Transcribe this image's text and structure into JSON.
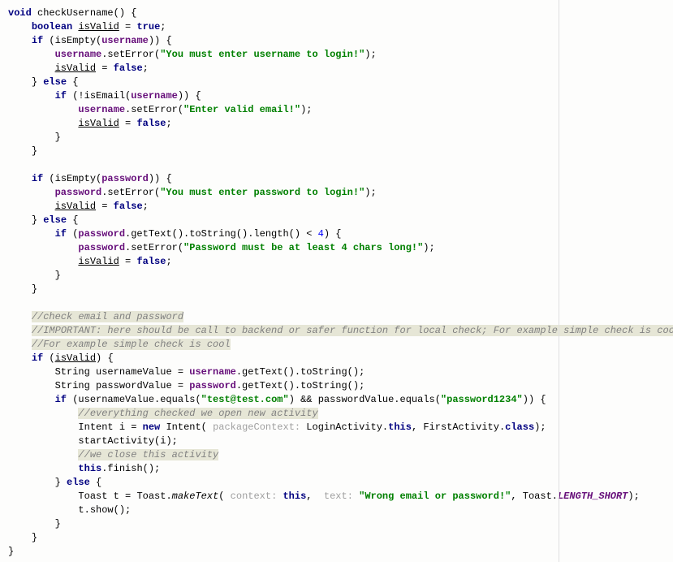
{
  "code": {
    "l1": {
      "kw1": "void",
      "name": "checkUsername",
      "rest": "() {"
    },
    "l2": {
      "kw1": "boolean",
      "var": "isValid",
      "assign": " = ",
      "kw2": "true",
      "semi": ";"
    },
    "l3": {
      "kw1": "if",
      "open": " (isEmpty(",
      "f": "username",
      "close": ")) {"
    },
    "l4": {
      "f": "username",
      "m": ".setError(",
      "s": "\"You must enter username to login!\"",
      "e": ");"
    },
    "l5": {
      "v": "isValid",
      "assign": " = ",
      "kw": "false",
      "semi": ";"
    },
    "l6": {
      "close": "} ",
      "kw": "else",
      "open": " {"
    },
    "l7": {
      "kw": "if",
      "open": " (!isEmail(",
      "f": "username",
      "close": ")) {"
    },
    "l8": {
      "f": "username",
      "m": ".setError(",
      "s": "\"Enter valid email!\"",
      "e": ");"
    },
    "l9": {
      "v": "isValid",
      "assign": " = ",
      "kw": "false",
      "semi": ";"
    },
    "l10": {
      "brace": "}"
    },
    "l11": {
      "brace": "}"
    },
    "l12": {
      "blank": ""
    },
    "l13": {
      "kw": "if",
      "open": " (isEmpty(",
      "f": "password",
      "close": ")) {"
    },
    "l14": {
      "f": "password",
      "m": ".setError(",
      "s": "\"You must enter password to login!\"",
      "e": ");"
    },
    "l15": {
      "v": "isValid",
      "assign": " = ",
      "kw": "false",
      "semi": ";"
    },
    "l16": {
      "close": "} ",
      "kw": "else",
      "open": " {"
    },
    "l17": {
      "kw": "if",
      "open": " (",
      "f": "password",
      "m": ".getText().toString().length() < ",
      "n": "4",
      "close": ") {"
    },
    "l18": {
      "f": "password",
      "m": ".setError(",
      "s": "\"Password must be at least 4 chars long!\"",
      "e": ");"
    },
    "l19": {
      "v": "isValid",
      "assign": " = ",
      "kw": "false",
      "semi": ";"
    },
    "l20": {
      "brace": "}"
    },
    "l21": {
      "brace": "}"
    },
    "l22": {
      "blank": ""
    },
    "l23": {
      "c": "//check email and password"
    },
    "l24": {
      "c": "//IMPORTANT: here should be call to backend or safer function for local check; For example simple check is cool"
    },
    "l25": {
      "c": "//For example simple check is cool"
    },
    "l26": {
      "kw": "if",
      "open": " (",
      "v": "isValid",
      "close": ") {"
    },
    "l27": {
      "t": "String ",
      "v": "usernameValue = ",
      "f": "username",
      "m": ".getText().toString();"
    },
    "l28": {
      "t": "String ",
      "v": "passwordValue = ",
      "f": "password",
      "m": ".getText().toString();"
    },
    "l29": {
      "kw": "if",
      "open": " (usernameValue.equals(",
      "s1": "\"test@test.com\"",
      "mid": ") && passwordValue.equals(",
      "s2": "\"password1234\"",
      "close": ")) {"
    },
    "l30": {
      "c": "//everything checked we open new activity"
    },
    "l31": {
      "t": "Intent ",
      "v": "i = ",
      "kw": "new",
      "sp": " Intent( ",
      "h": "packageContext: ",
      "a1": "LoginActivity.",
      "kw2": "this",
      "mid": ", FirstActivity.",
      "kw3": "class",
      "close": ");"
    },
    "l32": {
      "m": "startActivity(i);"
    },
    "l33": {
      "c": "//we close this activity"
    },
    "l34": {
      "kw": "this",
      "m": ".finish();"
    },
    "l35": {
      "close": "} ",
      "kw": "else",
      "open": " {"
    },
    "l36": {
      "t": "Toast ",
      "v": "t = Toast.",
      "mi": "makeText",
      "op": "( ",
      "h1": "context: ",
      "kw": "this",
      "mid": ",  ",
      "h2": "text: ",
      "s": "\"Wrong email or password!\"",
      "mid2": ", Toast.",
      "ci": "LENGTH_SHORT",
      "close": ");"
    },
    "l37": {
      "m": "t.show();"
    },
    "l38": {
      "brace": "}"
    },
    "l39": {
      "brace": "}"
    },
    "l40": {
      "brace": "}"
    }
  }
}
